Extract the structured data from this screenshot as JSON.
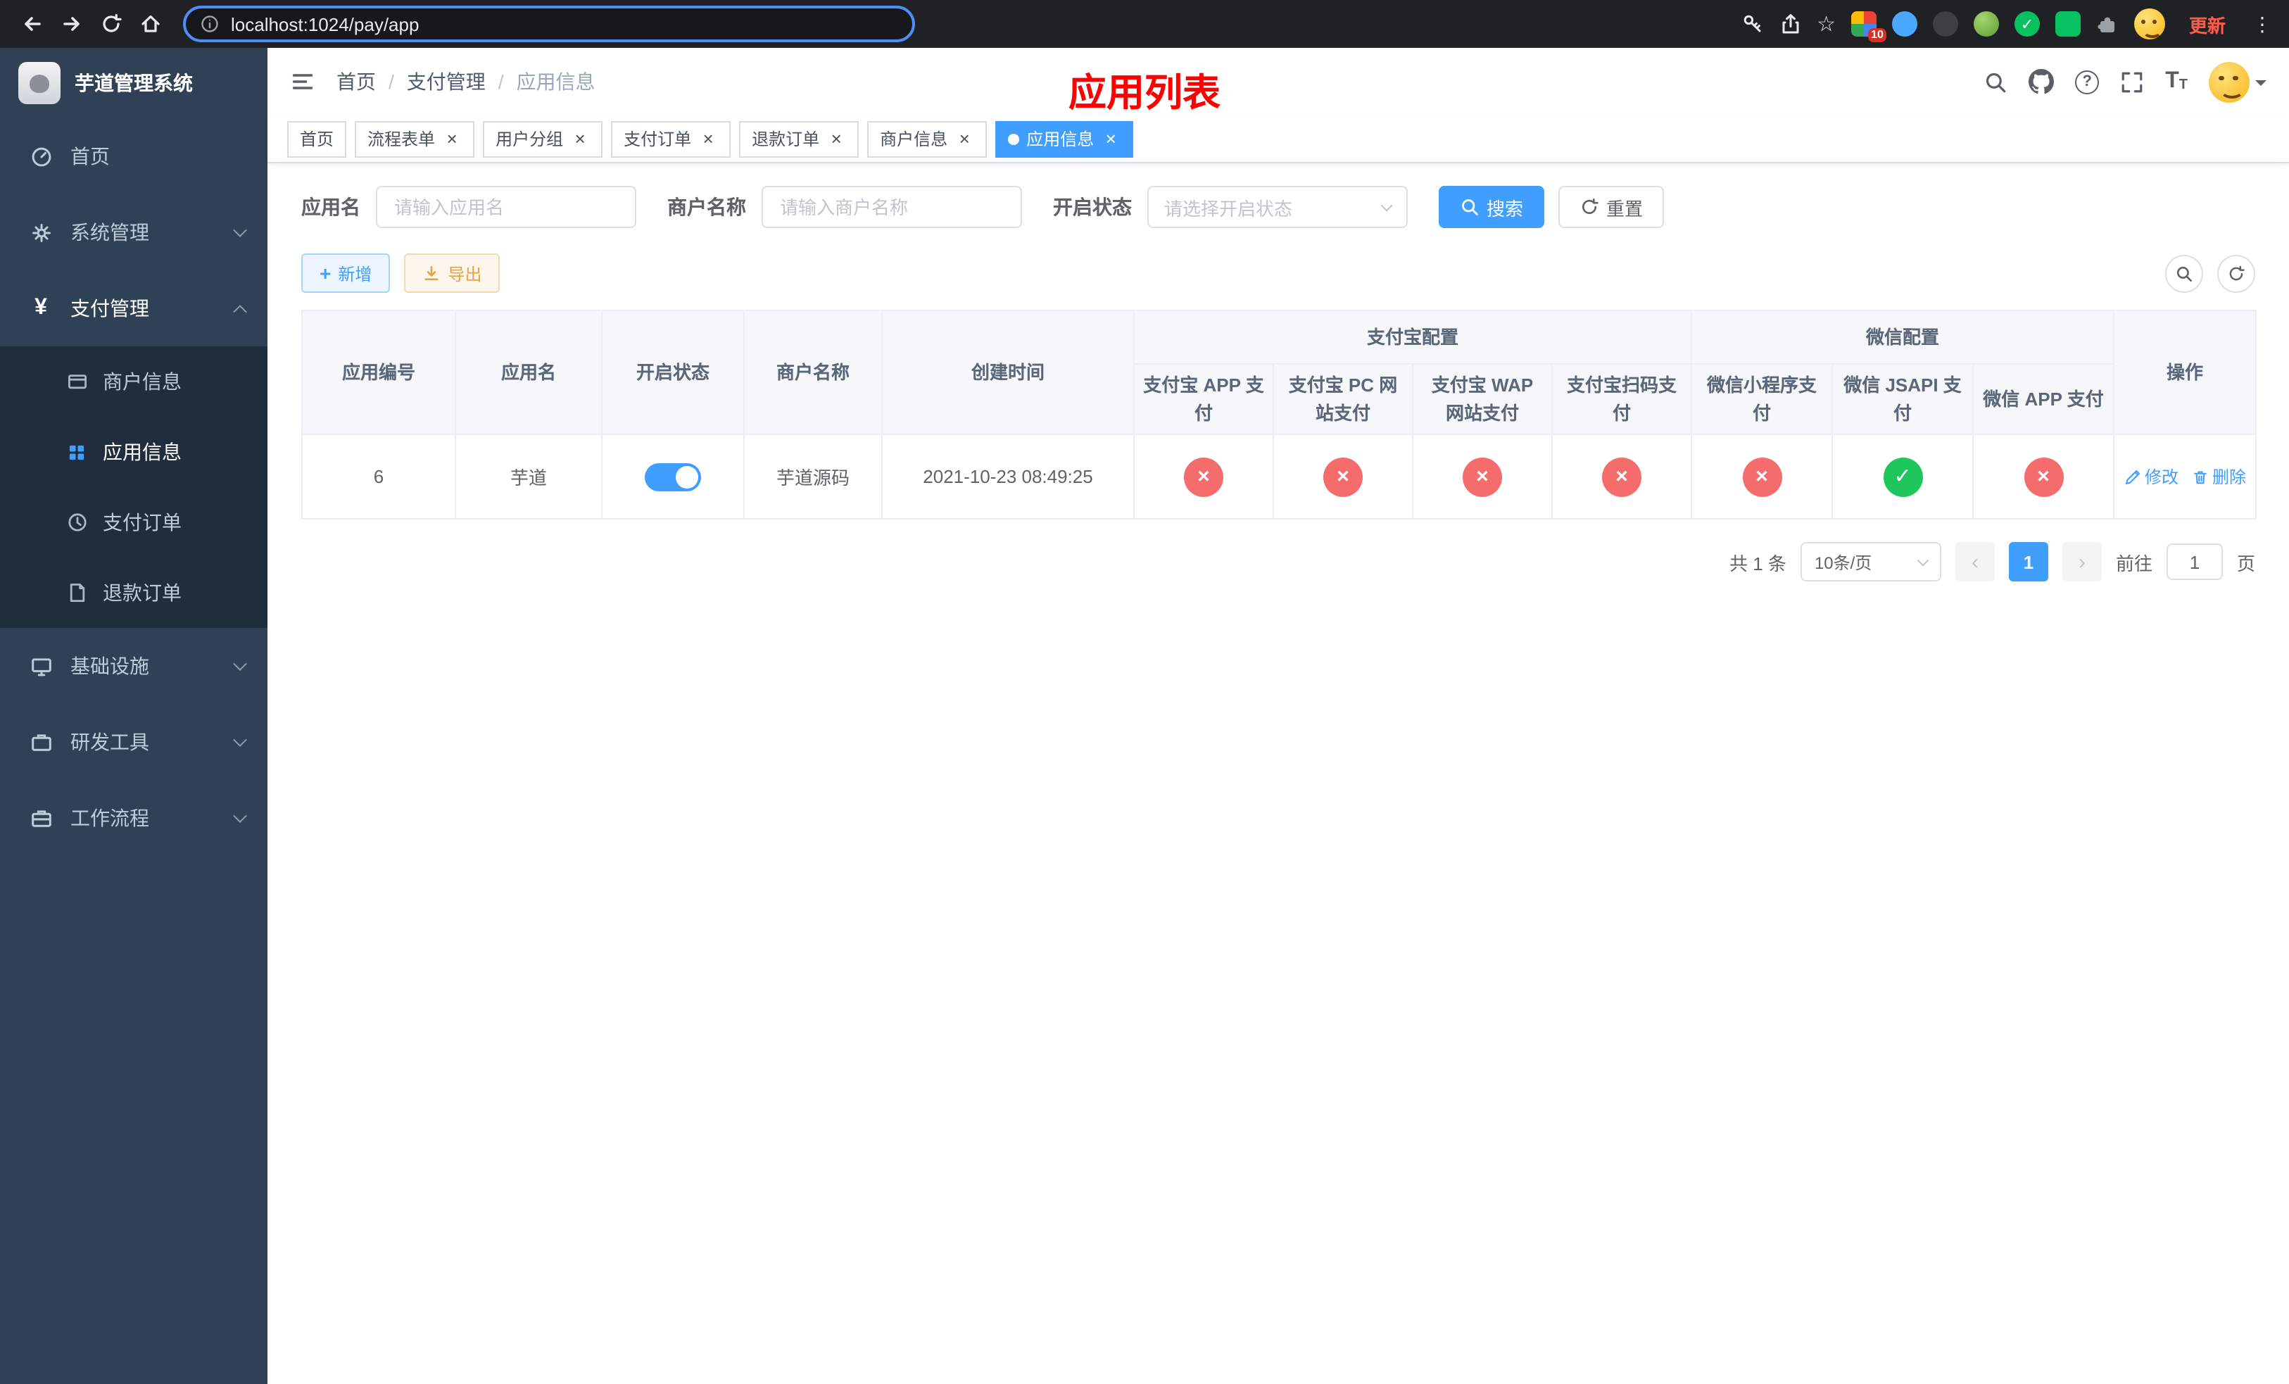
{
  "browser": {
    "url": "localhost:1024/pay/app",
    "update_label": "更新",
    "extension_badge": "10"
  },
  "sidebar": {
    "logo_title": "芋道管理系统",
    "items": [
      {
        "label": "首页",
        "expandable": false
      },
      {
        "label": "系统管理",
        "expandable": true
      },
      {
        "label": "支付管理",
        "expandable": true,
        "expanded": true
      },
      {
        "label": "基础设施",
        "expandable": true
      },
      {
        "label": "研发工具",
        "expandable": true
      },
      {
        "label": "工作流程",
        "expandable": true
      }
    ],
    "payment_children": [
      {
        "label": "商户信息",
        "active": false
      },
      {
        "label": "应用信息",
        "active": true
      },
      {
        "label": "支付订单",
        "active": false
      },
      {
        "label": "退款订单",
        "active": false
      }
    ]
  },
  "header": {
    "breadcrumb": [
      "首页",
      "支付管理",
      "应用信息"
    ],
    "page_title": "应用列表"
  },
  "tabs": [
    {
      "label": "首页",
      "closable": false,
      "active": false
    },
    {
      "label": "流程表单",
      "closable": true,
      "active": false
    },
    {
      "label": "用户分组",
      "closable": true,
      "active": false
    },
    {
      "label": "支付订单",
      "closable": true,
      "active": false
    },
    {
      "label": "退款订单",
      "closable": true,
      "active": false
    },
    {
      "label": "商户信息",
      "closable": true,
      "active": false
    },
    {
      "label": "应用信息",
      "closable": true,
      "active": true
    }
  ],
  "filters": {
    "app_name_label": "应用名",
    "app_name_placeholder": "请输入应用名",
    "merchant_label": "商户名称",
    "merchant_placeholder": "请输入商户名称",
    "status_label": "开启状态",
    "status_placeholder": "请选择开启状态",
    "search_label": "搜索",
    "reset_label": "重置"
  },
  "toolbar": {
    "add_label": "新增",
    "export_label": "导出"
  },
  "table": {
    "group_headers": {
      "alipay": "支付宝配置",
      "wechat": "微信配置"
    },
    "columns": {
      "app_id": "应用编号",
      "app_name": "应用名",
      "status": "开启状态",
      "merchant_name": "商户名称",
      "create_time": "创建时间",
      "alipay_app": "支付宝 APP 支付",
      "alipay_pc": "支付宝 PC 网站支付",
      "alipay_wap": "支付宝 WAP 网站支付",
      "alipay_qr": "支付宝扫码支付",
      "wx_lite": "微信小程序支付",
      "wx_jsapi": "微信 JSAPI 支付",
      "wx_app": "微信 APP 支付",
      "actions": "操作"
    },
    "row": {
      "app_id": "6",
      "app_name": "芋道",
      "status_on": true,
      "merchant_name": "芋道源码",
      "create_time": "2021-10-23 08:49:25",
      "channel_status": {
        "alipay_app": "disabled",
        "alipay_pc": "disabled",
        "alipay_wap": "disabled",
        "alipay_qr": "disabled",
        "wx_lite": "disabled",
        "wx_jsapi": "enabled",
        "wx_app": "disabled"
      },
      "edit_label": "修改",
      "delete_label": "删除"
    }
  },
  "pagination": {
    "total_text": "共 1 条",
    "page_size_value": "10条/页",
    "current_page": "1",
    "goto_label": "前往",
    "goto_value": "1",
    "page_unit": "页"
  },
  "icons": {
    "close": "×",
    "cross": "×",
    "check": "✓",
    "plus": "+",
    "kebab": "⋮",
    "star": "☆",
    "prev": "‹",
    "next": "›",
    "sep": "/",
    "question": "?",
    "yen": "¥",
    "text_size": "T",
    "text_size_small": "T"
  },
  "colors": {
    "primary": "#409eff",
    "danger": "#f56c6c",
    "success": "#1ec65b",
    "title_red": "#ff0000",
    "sidebar_bg": "#304156",
    "submenu_bg": "#1f2d3d"
  }
}
